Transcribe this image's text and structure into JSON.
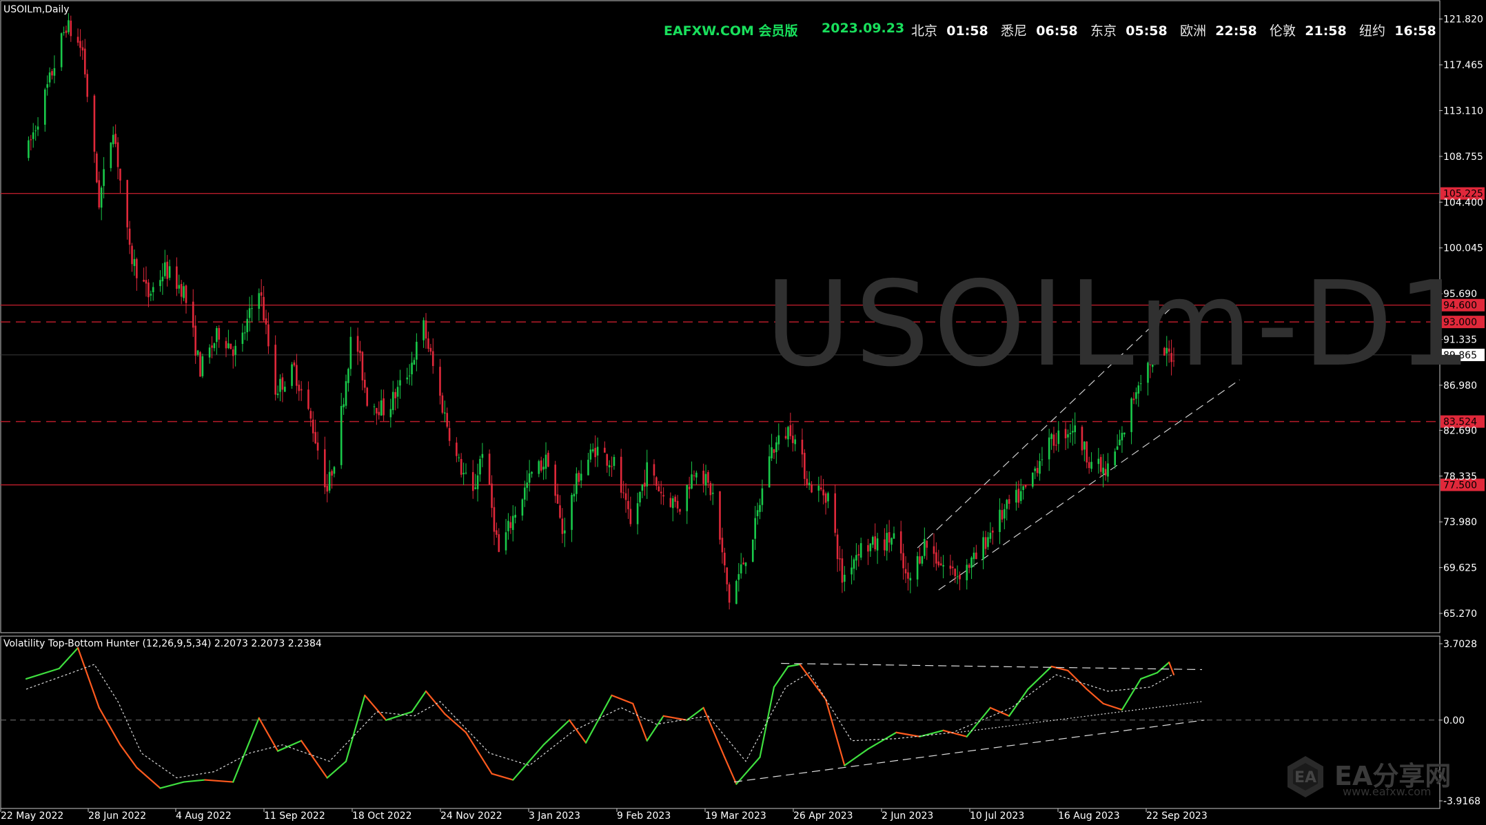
{
  "window": {
    "symbol_label": "USOILm,Daily",
    "watermark": "USOILm-D1"
  },
  "header": {
    "brand": "EAFXW.COM 会员版",
    "date": "2023.09.23",
    "clocks": [
      {
        "city": "北京",
        "time": "01:58"
      },
      {
        "city": "悉尼",
        "time": "06:58"
      },
      {
        "city": "东京",
        "time": "05:58"
      },
      {
        "city": "欧洲",
        "time": "22:58"
      },
      {
        "city": "伦敦",
        "time": "21:58"
      },
      {
        "city": "纽约",
        "time": "16:58"
      }
    ]
  },
  "indicator": {
    "label": "Volatility Top-Bottom Hunter (12,26,9,5,34) 2.2073 2.2073 2.2384"
  },
  "logo": {
    "text": "EA分享网",
    "url_text": "www.eafxw.com"
  },
  "colors": {
    "bull": "#19c94a",
    "bear": "#e0283a",
    "level": "#b81c2a",
    "osc_up": "#3fe03f",
    "osc_down": "#ff5a1e"
  },
  "chart_data": [
    {
      "type": "candlestick",
      "symbol": "USOILm",
      "timeframe": "Daily",
      "ylim": [
        63.5,
        123.5
      ],
      "y_ticks": [
        "121.820",
        "117.465",
        "113.110",
        "108.755",
        "104.400",
        "100.045",
        "95.690",
        "91.335",
        "86.980",
        "82.690",
        "78.335",
        "73.980",
        "69.625",
        "65.270"
      ],
      "x_ticks": [
        "22 May 2022",
        "28 Jun 2022",
        "4 Aug 2022",
        "11 Sep 2022",
        "18 Oct 2022",
        "24 Nov 2022",
        "3 Jan 2023",
        "9 Feb 2023",
        "19 Mar 2023",
        "26 Apr 2023",
        "2 Jun 2023",
        "10 Jul 2023",
        "16 Aug 2023",
        "22 Sep 2023"
      ],
      "current_price": "89.865",
      "levels": [
        {
          "value": 105.225,
          "label": "105.225",
          "style": "solid"
        },
        {
          "value": 94.6,
          "label": "94.600",
          "style": "solid"
        },
        {
          "value": 93.0,
          "label": "93.000",
          "style": "dashed"
        },
        {
          "value": 83.524,
          "label": "83.524",
          "style": "dashed"
        },
        {
          "value": 77.5,
          "label": "77.500",
          "style": "solid"
        }
      ],
      "path": [
        [
          "2022-05-22",
          108.8
        ],
        [
          "2022-06-01",
          116.0
        ],
        [
          "2022-06-08",
          121.3
        ],
        [
          "2022-06-15",
          118.8
        ],
        [
          "2022-06-22",
          104.4
        ],
        [
          "2022-06-28",
          111.7
        ],
        [
          "2022-07-05",
          99.5
        ],
        [
          "2022-07-13",
          95.5
        ],
        [
          "2022-07-20",
          98.0
        ],
        [
          "2022-07-28",
          96.0
        ],
        [
          "2022-08-04",
          88.5
        ],
        [
          "2022-08-12",
          92.0
        ],
        [
          "2022-08-20",
          90.0
        ],
        [
          "2022-08-29",
          96.5
        ],
        [
          "2022-09-05",
          86.5
        ],
        [
          "2022-09-13",
          88.5
        ],
        [
          "2022-09-21",
          82.9
        ],
        [
          "2022-09-27",
          77.0
        ],
        [
          "2022-10-01",
          81.0
        ],
        [
          "2022-10-08",
          92.7
        ],
        [
          "2022-10-14",
          85.7
        ],
        [
          "2022-10-22",
          84.5
        ],
        [
          "2022-11-01",
          88.5
        ],
        [
          "2022-11-07",
          92.6
        ],
        [
          "2022-11-14",
          85.8
        ],
        [
          "2022-11-21",
          80.0
        ],
        [
          "2022-11-28",
          76.5
        ],
        [
          "2022-12-02",
          81.0
        ],
        [
          "2022-12-09",
          71.0
        ],
        [
          "2022-12-16",
          75.0
        ],
        [
          "2022-12-23",
          78.5
        ],
        [
          "2022-12-30",
          80.0
        ],
        [
          "2023-01-05",
          73.0
        ],
        [
          "2023-01-12",
          78.5
        ],
        [
          "2023-01-19",
          81.0
        ],
        [
          "2023-01-27",
          79.5
        ],
        [
          "2023-02-03",
          73.5
        ],
        [
          "2023-02-10",
          79.0
        ],
        [
          "2023-02-17",
          76.5
        ],
        [
          "2023-02-24",
          75.5
        ],
        [
          "2023-03-03",
          79.5
        ],
        [
          "2023-03-10",
          76.5
        ],
        [
          "2023-03-17",
          66.5
        ],
        [
          "2023-03-22",
          69.5
        ],
        [
          "2023-03-28",
          73.5
        ],
        [
          "2023-04-03",
          80.5
        ],
        [
          "2023-04-12",
          83.0
        ],
        [
          "2023-04-20",
          77.5
        ],
        [
          "2023-04-28",
          76.5
        ],
        [
          "2023-05-04",
          68.5
        ],
        [
          "2023-05-11",
          71.5
        ],
        [
          "2023-05-19",
          71.8
        ],
        [
          "2023-05-26",
          72.5
        ],
        [
          "2023-06-01",
          68.0
        ],
        [
          "2023-06-08",
          72.0
        ],
        [
          "2023-06-15",
          70.0
        ],
        [
          "2023-06-22",
          69.0
        ],
        [
          "2023-06-30",
          70.5
        ],
        [
          "2023-07-07",
          73.5
        ],
        [
          "2023-07-14",
          75.5
        ],
        [
          "2023-07-21",
          77.0
        ],
        [
          "2023-07-28",
          80.5
        ],
        [
          "2023-08-03",
          82.0
        ],
        [
          "2023-08-10",
          83.0
        ],
        [
          "2023-08-17",
          80.0
        ],
        [
          "2023-08-24",
          78.5
        ],
        [
          "2023-08-31",
          82.0
        ],
        [
          "2023-09-07",
          87.5
        ],
        [
          "2023-09-14",
          90.0
        ],
        [
          "2023-09-22",
          89.865
        ]
      ],
      "channel": {
        "upper": [
          [
            "2023-06-05",
            71.5
          ],
          [
            "2023-09-24",
            95.0
          ]
        ],
        "lower": [
          [
            "2023-06-14",
            67.5
          ],
          [
            "2023-10-20",
            87.5
          ]
        ]
      }
    },
    {
      "type": "line",
      "name": "Volatility Top-Bottom Hunter (12,26,9,5,34)",
      "ylim": [
        -3.9168,
        3.7028
      ],
      "y_ticks": [
        "3.7028",
        "0.00",
        "-3.9168"
      ],
      "values_shown": [
        "2.2073",
        "2.2073",
        "2.2384"
      ],
      "oscillator": [
        [
          "2022-05-22",
          2.0
        ],
        [
          "2022-06-05",
          2.5
        ],
        [
          "2022-06-13",
          3.5
        ],
        [
          "2022-06-22",
          0.6
        ],
        [
          "2022-07-01",
          -1.2
        ],
        [
          "2022-07-08",
          -2.3
        ],
        [
          "2022-07-18",
          -3.3
        ],
        [
          "2022-07-28",
          -3.0
        ],
        [
          "2022-08-06",
          -2.9
        ],
        [
          "2022-08-18",
          -3.0
        ],
        [
          "2022-08-29",
          0.1
        ],
        [
          "2022-09-06",
          -1.5
        ],
        [
          "2022-09-16",
          -1.0
        ],
        [
          "2022-09-27",
          -2.8
        ],
        [
          "2022-10-05",
          -2.0
        ],
        [
          "2022-10-13",
          1.2
        ],
        [
          "2022-10-22",
          0.0
        ],
        [
          "2022-11-02",
          0.4
        ],
        [
          "2022-11-08",
          1.4
        ],
        [
          "2022-11-16",
          0.3
        ],
        [
          "2022-11-25",
          -0.6
        ],
        [
          "2022-12-06",
          -2.6
        ],
        [
          "2022-12-15",
          -2.9
        ],
        [
          "2022-12-28",
          -1.2
        ],
        [
          "2023-01-08",
          0.0
        ],
        [
          "2023-01-15",
          -1.1
        ],
        [
          "2023-01-26",
          1.2
        ],
        [
          "2023-02-04",
          0.8
        ],
        [
          "2023-02-10",
          -1.0
        ],
        [
          "2023-02-17",
          0.2
        ],
        [
          "2023-02-27",
          0.0
        ],
        [
          "2023-03-06",
          0.6
        ],
        [
          "2023-03-15",
          -1.8
        ],
        [
          "2023-03-20",
          -3.1
        ],
        [
          "2023-03-30",
          -1.8
        ],
        [
          "2023-04-05",
          1.6
        ],
        [
          "2023-04-11",
          2.6
        ],
        [
          "2023-04-16",
          2.7
        ],
        [
          "2023-04-27",
          1.0
        ],
        [
          "2023-05-05",
          -2.2
        ],
        [
          "2023-05-15",
          -1.4
        ],
        [
          "2023-05-27",
          -0.6
        ],
        [
          "2023-06-06",
          -0.8
        ],
        [
          "2023-06-16",
          -0.5
        ],
        [
          "2023-06-26",
          -0.8
        ],
        [
          "2023-07-06",
          0.6
        ],
        [
          "2023-07-14",
          0.2
        ],
        [
          "2023-07-22",
          1.5
        ],
        [
          "2023-08-01",
          2.6
        ],
        [
          "2023-08-08",
          2.4
        ],
        [
          "2023-08-16",
          1.5
        ],
        [
          "2023-08-23",
          0.8
        ],
        [
          "2023-08-31",
          0.5
        ],
        [
          "2023-09-08",
          2.0
        ],
        [
          "2023-09-15",
          2.3
        ],
        [
          "2023-09-20",
          2.8
        ],
        [
          "2023-09-22",
          2.2073
        ]
      ],
      "signal": [
        [
          "2022-05-22",
          1.5
        ],
        [
          "2022-06-08",
          2.2
        ],
        [
          "2022-06-20",
          2.7
        ],
        [
          "2022-06-30",
          0.9
        ],
        [
          "2022-07-10",
          -1.6
        ],
        [
          "2022-07-25",
          -2.8
        ],
        [
          "2022-08-10",
          -2.5
        ],
        [
          "2022-08-25",
          -1.6
        ],
        [
          "2022-09-08",
          -1.2
        ],
        [
          "2022-09-28",
          -2.0
        ],
        [
          "2022-10-18",
          0.4
        ],
        [
          "2022-11-03",
          0.2
        ],
        [
          "2022-11-14",
          0.9
        ],
        [
          "2022-12-05",
          -1.6
        ],
        [
          "2022-12-22",
          -2.2
        ],
        [
          "2023-01-10",
          -0.5
        ],
        [
          "2023-01-30",
          0.6
        ],
        [
          "2023-02-14",
          -0.2
        ],
        [
          "2023-03-08",
          0.2
        ],
        [
          "2023-03-24",
          -2.0
        ],
        [
          "2023-04-10",
          1.6
        ],
        [
          "2023-04-20",
          2.3
        ],
        [
          "2023-05-08",
          -1.0
        ],
        [
          "2023-05-27",
          -0.9
        ],
        [
          "2023-06-20",
          -0.6
        ],
        [
          "2023-07-15",
          0.6
        ],
        [
          "2023-08-03",
          2.2
        ],
        [
          "2023-08-25",
          1.4
        ],
        [
          "2023-09-12",
          1.6
        ],
        [
          "2023-09-22",
          2.2384
        ]
      ],
      "trendlines": {
        "top": [
          [
            "2023-04-08",
            2.75
          ],
          [
            "2023-10-04",
            2.45
          ]
        ],
        "bottom": [
          [
            "2023-03-19",
            -3.0
          ],
          [
            "2023-10-05",
            0.0
          ]
        ],
        "dotted": [
          [
            "2023-06-22",
            -0.6
          ],
          [
            "2023-10-04",
            0.9
          ]
        ]
      }
    }
  ]
}
